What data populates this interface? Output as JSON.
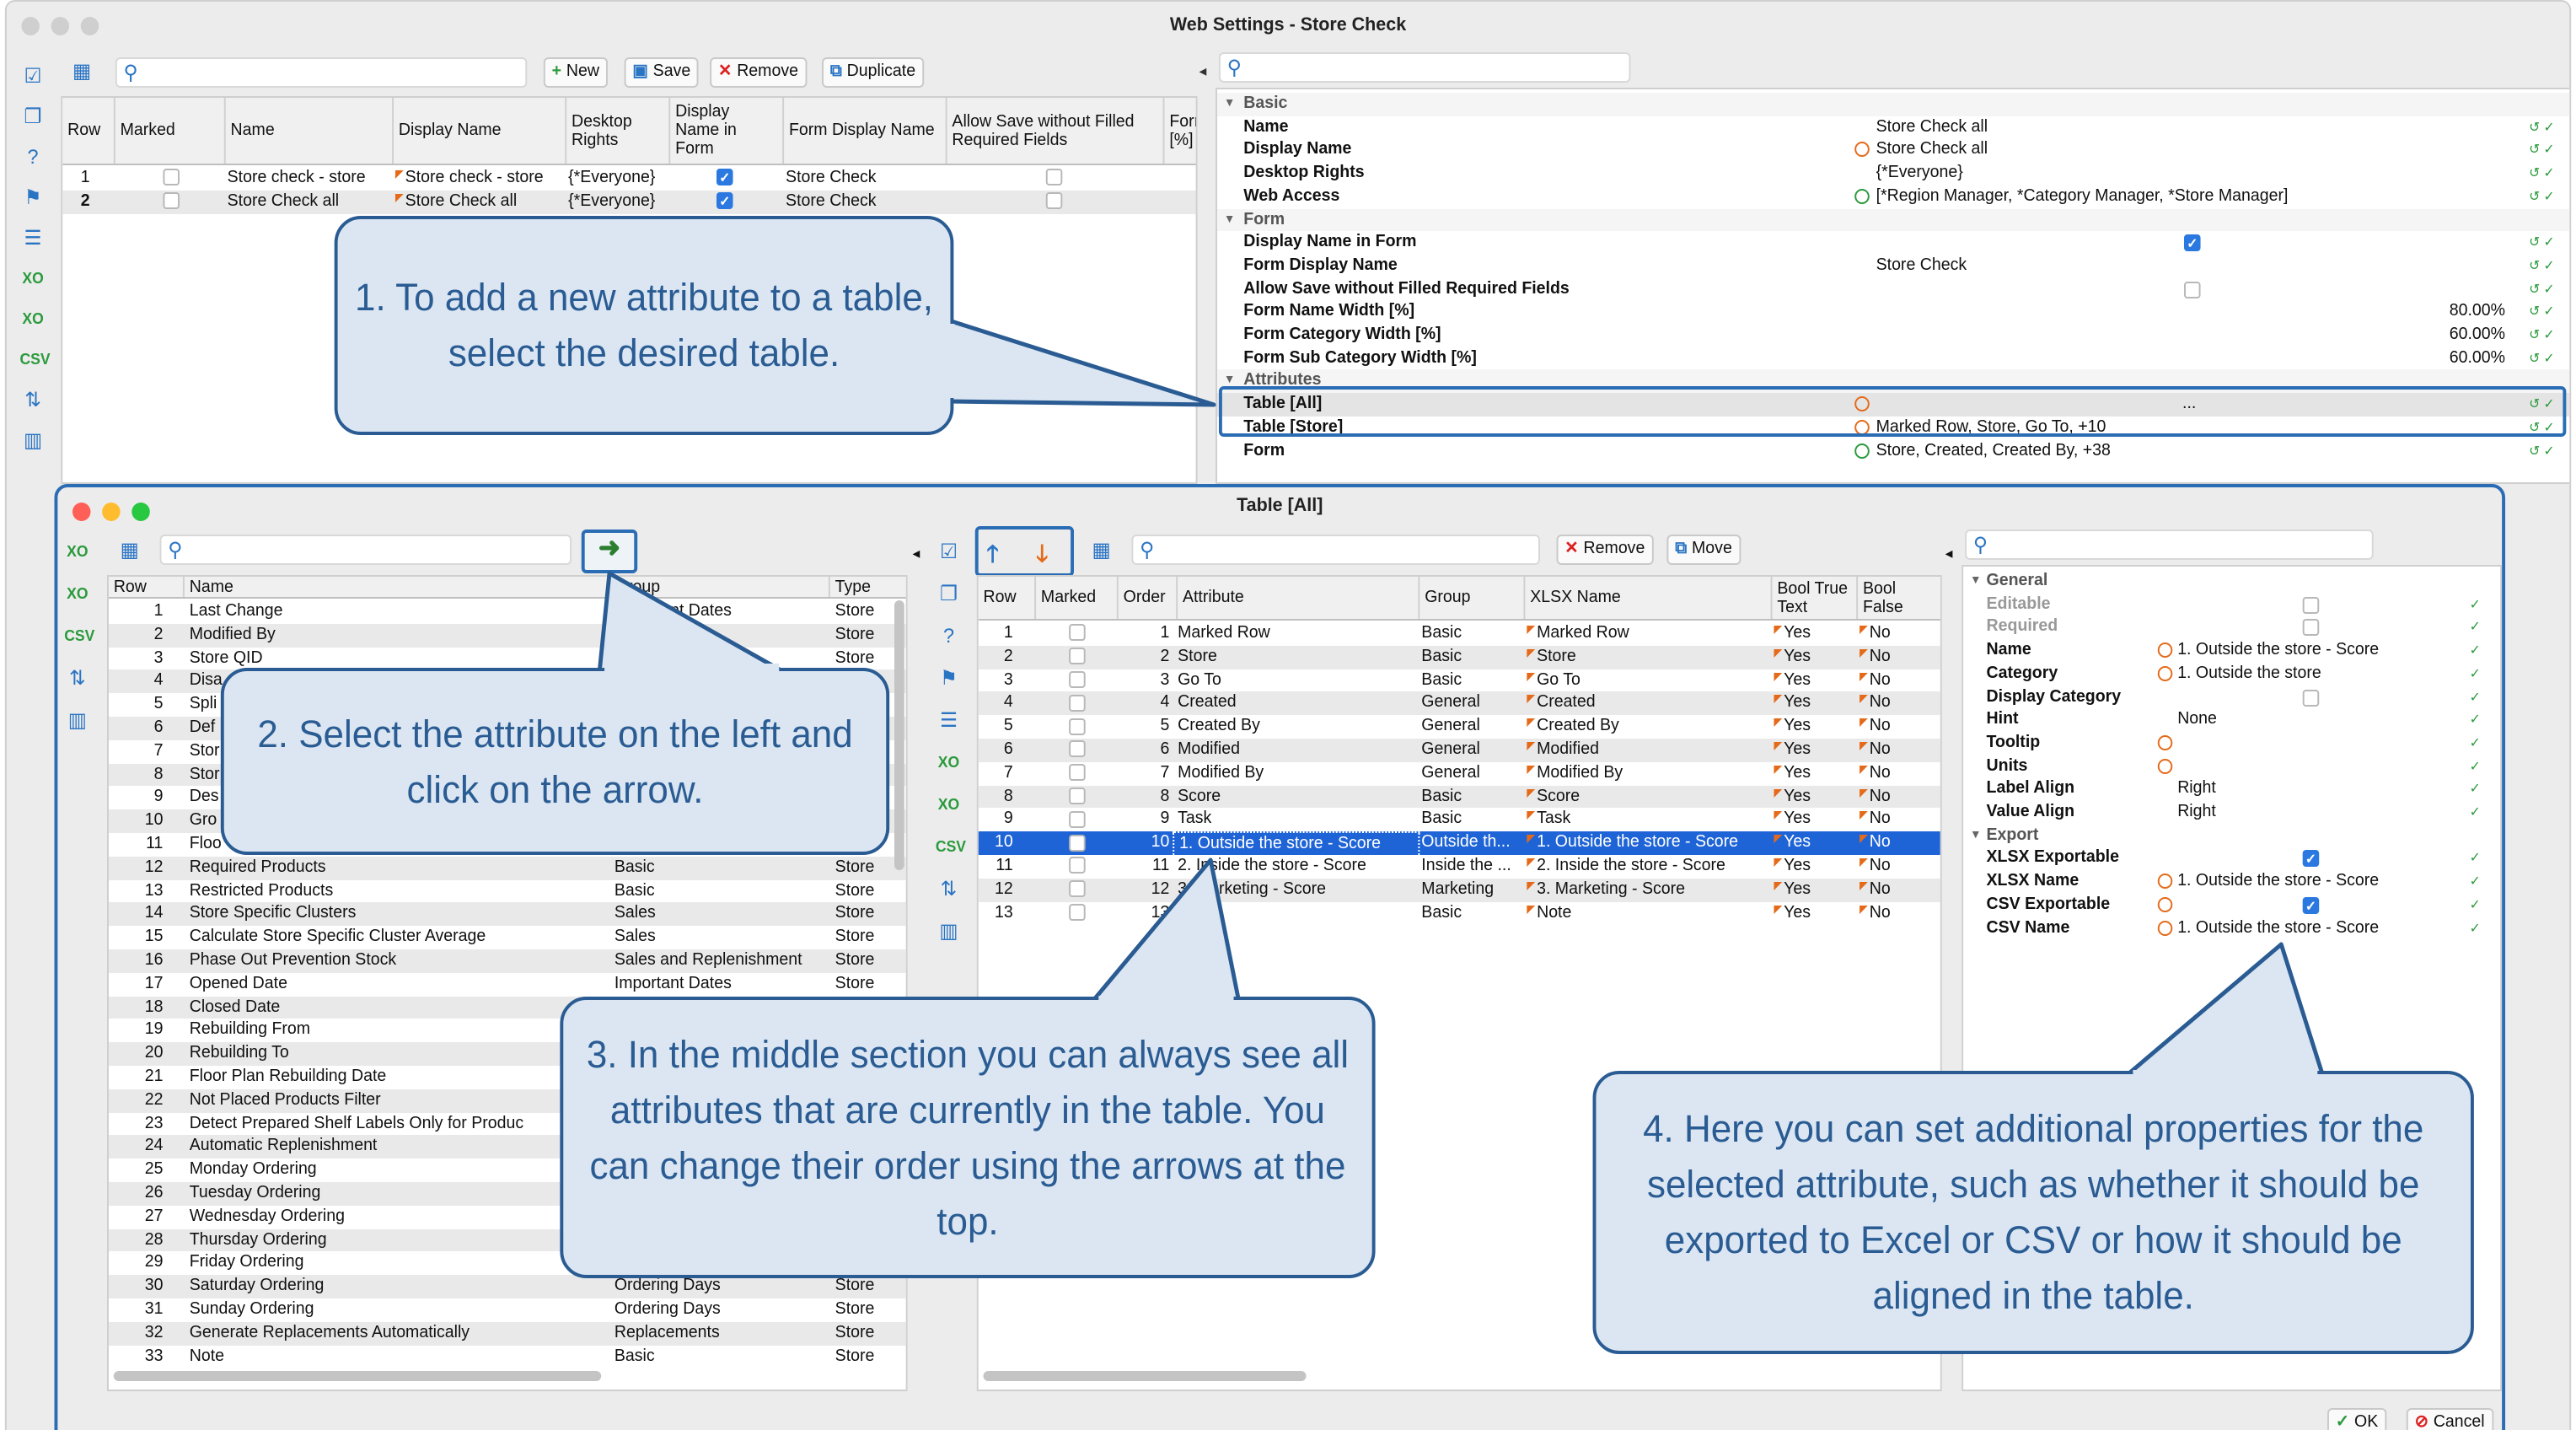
{
  "main_window": {
    "title": "Web Settings - Store Check",
    "toolbar": {
      "new": "New",
      "save": "Save",
      "remove": "Remove",
      "duplicate": "Duplicate"
    }
  },
  "main_table": {
    "headers": [
      "Row",
      "Marked",
      "Name",
      "Display Name",
      "Desktop Rights",
      "Display Name in Form",
      "Form Display Name",
      "Allow Save without Filled Required Fields",
      "Form [%]"
    ],
    "rows": [
      {
        "row": "1",
        "name": "Store check - store",
        "display_name": "Store check - store",
        "rights": "{*Everyone}",
        "form_display": "Store Check"
      },
      {
        "row": "2",
        "name": "Store Check all",
        "display_name": "Store Check all",
        "rights": "{*Everyone}",
        "form_display": "Store Check"
      }
    ]
  },
  "top_props": {
    "groups": {
      "basic": "Basic",
      "form": "Form",
      "attributes": "Attributes"
    },
    "rows": [
      {
        "k": "Name",
        "v": "Store Check all"
      },
      {
        "k": "Display Name",
        "v": "Store Check all"
      },
      {
        "k": "Desktop Rights",
        "v": "{*Everyone}"
      },
      {
        "k": "Web Access",
        "v": "[*Region Manager, *Category Manager, *Store Manager]"
      },
      {
        "k": "Display Name in Form",
        "v": ""
      },
      {
        "k": "Form Display Name",
        "v": "Store Check"
      },
      {
        "k": "Allow Save without Filled Required Fields",
        "v": ""
      },
      {
        "k": "Form Name Width [%]",
        "v": "80.00%"
      },
      {
        "k": "Form Category Width [%]",
        "v": "60.00%"
      },
      {
        "k": "Form Sub Category Width [%]",
        "v": "60.00%"
      },
      {
        "k": "Table [All]",
        "v": "..."
      },
      {
        "k": "Table [Store]",
        "v": "Marked Row, Store, Go To, +10"
      },
      {
        "k": "Form",
        "v": "Store, Created, Created By, +38"
      }
    ]
  },
  "dialog": {
    "title": "Table [All]",
    "ok": "OK",
    "cancel": "Cancel",
    "remove": "Remove",
    "move": "Move"
  },
  "left_table": {
    "headers": [
      "Row",
      "Name",
      "Group",
      "Type"
    ],
    "rows": [
      [
        "1",
        "Last Change",
        "Important Dates",
        "Store"
      ],
      [
        "2",
        "Modified By",
        "",
        "Store"
      ],
      [
        "3",
        "Store QID",
        "",
        "Store"
      ],
      [
        "4",
        "Disa",
        "",
        "Store"
      ],
      [
        "5",
        "Spli",
        "",
        "Store"
      ],
      [
        "6",
        "Def",
        "",
        "Store"
      ],
      [
        "7",
        "Stor",
        "",
        "Store"
      ],
      [
        "8",
        "Stor",
        "",
        "Store"
      ],
      [
        "9",
        "Des",
        "",
        "Store"
      ],
      [
        "10",
        "Gro",
        "",
        "Store"
      ],
      [
        "11",
        "Floo",
        "",
        "Store"
      ],
      [
        "12",
        "Required Products",
        "Basic",
        "Store"
      ],
      [
        "13",
        "Restricted Products",
        "Basic",
        "Store"
      ],
      [
        "14",
        "Store Specific Clusters",
        "Sales",
        "Store"
      ],
      [
        "15",
        "Calculate Store Specific Cluster Average",
        "Sales",
        "Store"
      ],
      [
        "16",
        "Phase Out Prevention Stock",
        "Sales and Replenishment",
        "Store"
      ],
      [
        "17",
        "Opened Date",
        "Important Dates",
        "Store"
      ],
      [
        "18",
        "Closed Date",
        "",
        ""
      ],
      [
        "19",
        "Rebuilding From",
        "",
        ""
      ],
      [
        "20",
        "Rebuilding To",
        "",
        ""
      ],
      [
        "21",
        "Floor Plan Rebuilding Date",
        "",
        ""
      ],
      [
        "22",
        "Not Placed Products Filter",
        "",
        ""
      ],
      [
        "23",
        "Detect Prepared Shelf Labels Only for Produc",
        "",
        ""
      ],
      [
        "24",
        "Automatic Replenishment",
        "",
        ""
      ],
      [
        "25",
        "Monday Ordering",
        "",
        ""
      ],
      [
        "26",
        "Tuesday Ordering",
        "",
        ""
      ],
      [
        "27",
        "Wednesday Ordering",
        "",
        ""
      ],
      [
        "28",
        "Thursday Ordering",
        "",
        ""
      ],
      [
        "29",
        "Friday Ordering",
        "",
        ""
      ],
      [
        "30",
        "Saturday Ordering",
        "Ordering Days",
        "Store"
      ],
      [
        "31",
        "Sunday Ordering",
        "Ordering Days",
        "Store"
      ],
      [
        "32",
        "Generate Replacements Automatically",
        "Replacements",
        "Store"
      ],
      [
        "33",
        "Note",
        "Basic",
        "Store"
      ]
    ]
  },
  "mid_table": {
    "headers": [
      "Row",
      "Marked",
      "Order",
      "Attribute",
      "Group",
      "XLSX Name",
      "Bool True Text",
      "Bool False"
    ],
    "rows": [
      [
        "1",
        "1",
        "Marked Row",
        "Basic",
        "Marked Row",
        "Yes",
        "No"
      ],
      [
        "2",
        "2",
        "Store",
        "Basic",
        "Store",
        "Yes",
        "No"
      ],
      [
        "3",
        "3",
        "Go To",
        "Basic",
        "Go To",
        "Yes",
        "No"
      ],
      [
        "4",
        "4",
        "Created",
        "General",
        "Created",
        "Yes",
        "No"
      ],
      [
        "5",
        "5",
        "Created By",
        "General",
        "Created By",
        "Yes",
        "No"
      ],
      [
        "6",
        "6",
        "Modified",
        "General",
        "Modified",
        "Yes",
        "No"
      ],
      [
        "7",
        "7",
        "Modified By",
        "General",
        "Modified By",
        "Yes",
        "No"
      ],
      [
        "8",
        "8",
        "Score",
        "Basic",
        "Score",
        "Yes",
        "No"
      ],
      [
        "9",
        "9",
        "Task",
        "Basic",
        "Task",
        "Yes",
        "No"
      ],
      [
        "10",
        "10",
        "1. Outside the store - Score",
        "Outside th...",
        "1. Outside the store - Score",
        "Yes",
        "No"
      ],
      [
        "11",
        "11",
        "2. Inside the store - Score",
        "Inside the ...",
        "2. Inside the store - Score",
        "Yes",
        "No"
      ],
      [
        "12",
        "12",
        "3. Marketing - Score",
        "Marketing",
        "3. Marketing - Score",
        "Yes",
        "No"
      ],
      [
        "13",
        "13",
        "",
        "Basic",
        "Note",
        "Yes",
        "No"
      ]
    ]
  },
  "right_props": {
    "groups": {
      "general": "General",
      "export": "Export"
    },
    "rows": [
      {
        "k": "Editable",
        "v": ""
      },
      {
        "k": "Required",
        "v": ""
      },
      {
        "k": "Name",
        "v": "1. Outside the store - Score"
      },
      {
        "k": "Category",
        "v": "1. Outside the store"
      },
      {
        "k": "Display Category",
        "v": ""
      },
      {
        "k": "Hint",
        "v": "None"
      },
      {
        "k": "Tooltip",
        "v": ""
      },
      {
        "k": "Units",
        "v": ""
      },
      {
        "k": "Label Align",
        "v": "Right"
      },
      {
        "k": "Value Align",
        "v": "Right"
      },
      {
        "k": "XLSX Exportable",
        "v": ""
      },
      {
        "k": "XLSX Name",
        "v": "1. Outside the store - Score"
      },
      {
        "k": "CSV Exportable",
        "v": ""
      },
      {
        "k": "CSV Name",
        "v": "1. Outside the store - Score"
      }
    ]
  },
  "callouts": {
    "c1": "1. To add a new attribute to a table, select the desired table.",
    "c2": "2. Select the attribute on the left and click on the arrow.",
    "c3": "3. In the middle section you can always see all attributes that are currently in the table. You can change their order using the arrows at the top.",
    "c4": "4. Here you can set additional properties for the selected attribute, such as whether it should be exported to Excel or CSV or how it should be aligned in the table."
  },
  "colors": {
    "accent": "#2a5c93",
    "selection": "#1f64d6",
    "callout_bg": "#dbe6f2"
  }
}
